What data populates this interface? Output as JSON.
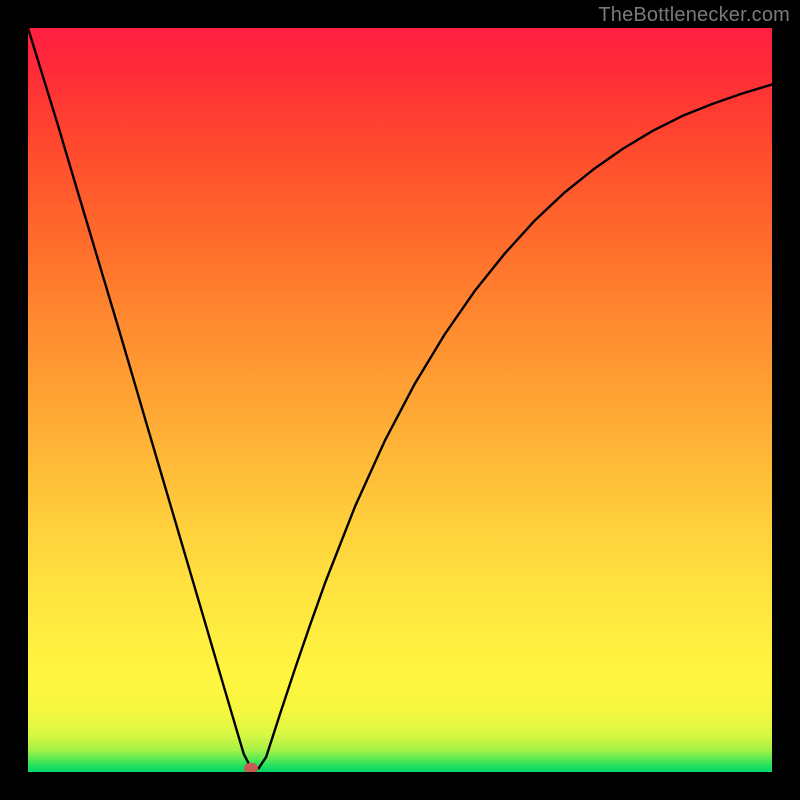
{
  "watermark": "TheBottlenecker.com",
  "chart_data": {
    "type": "line",
    "title": "",
    "xlabel": "",
    "ylabel": "",
    "xlim": [
      0,
      100
    ],
    "ylim": [
      0,
      100
    ],
    "grid": false,
    "series": [
      {
        "name": "curve",
        "color": "#000000",
        "x": [
          0,
          2,
          4,
          6,
          8,
          10,
          12,
          14,
          16,
          18,
          20,
          22,
          24,
          26,
          28,
          29,
          30,
          31,
          32,
          34,
          36,
          38,
          40,
          44,
          48,
          52,
          56,
          60,
          64,
          68,
          72,
          76,
          80,
          84,
          88,
          92,
          96,
          100
        ],
        "y": [
          100,
          93.5,
          87,
          80.3,
          73.6,
          66.9,
          60.2,
          53.4,
          46.6,
          39.8,
          33,
          26.2,
          19.4,
          12.6,
          5.8,
          2.4,
          0.5,
          0.5,
          2,
          8.2,
          14.2,
          20,
          25.6,
          35.8,
          44.6,
          52.2,
          58.8,
          64.6,
          69.6,
          74,
          77.8,
          81,
          83.8,
          86.2,
          88.2,
          89.8,
          91.2,
          92.4
        ]
      }
    ],
    "marker": {
      "x": 30,
      "y": 0.5,
      "color": "#c85a54"
    },
    "background_gradient": {
      "stops": [
        {
          "pct": 0,
          "color": "#00d56a"
        },
        {
          "pct": 8,
          "color": "#f4f73f"
        },
        {
          "pct": 25,
          "color": "#ffe23f"
        },
        {
          "pct": 52,
          "color": "#ff9f33"
        },
        {
          "pct": 85,
          "color": "#ff472e"
        },
        {
          "pct": 100,
          "color": "#ff1f42"
        }
      ]
    }
  }
}
